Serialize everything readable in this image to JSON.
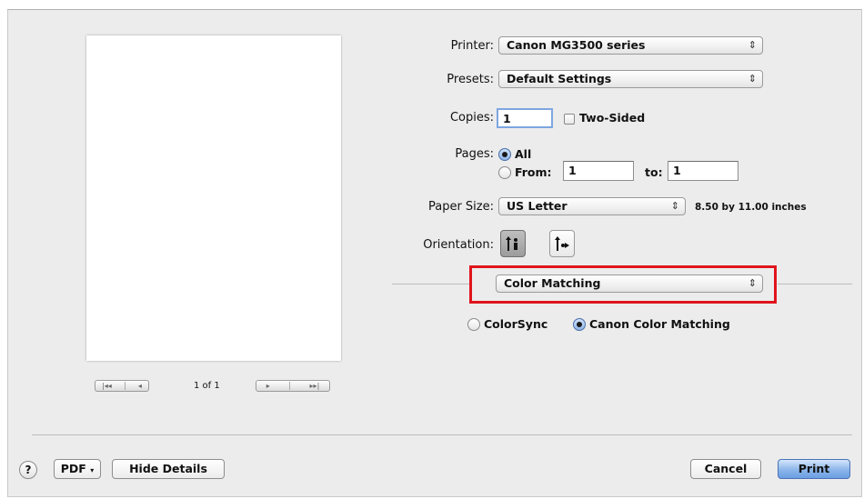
{
  "preview": {
    "nav_first_prev": [
      "|◂◂",
      "◂"
    ],
    "nav_next_last": [
      "▸",
      "▸▸|"
    ],
    "page_counter": "1 of 1"
  },
  "printer": {
    "label": "Printer:",
    "value": "Canon MG3500 series"
  },
  "presets": {
    "label": "Presets:",
    "value": "Default Settings"
  },
  "copies": {
    "label": "Copies:",
    "value": "1",
    "two_sided_label": "Two-Sided",
    "two_sided_checked": false
  },
  "pages": {
    "label": "Pages:",
    "all_label": "All",
    "from_label": "From:",
    "from_value": "1",
    "to_label": "to:",
    "to_value": "1",
    "selected": "All"
  },
  "paper_size": {
    "label": "Paper Size:",
    "value": "US Letter",
    "dimensions": "8.50 by 11.00 inches"
  },
  "orientation": {
    "label": "Orientation:",
    "selected": "portrait"
  },
  "section_popup": {
    "value": "Color Matching",
    "highlight_color": "#e0141c"
  },
  "color_matching": {
    "colorsync_label": "ColorSync",
    "canon_label": "Canon Color Matching",
    "selected": "Canon Color Matching"
  },
  "footer": {
    "help_symbol": "?",
    "pdf_label": "PDF",
    "hide_details_label": "Hide Details",
    "cancel_label": "Cancel",
    "print_label": "Print"
  }
}
